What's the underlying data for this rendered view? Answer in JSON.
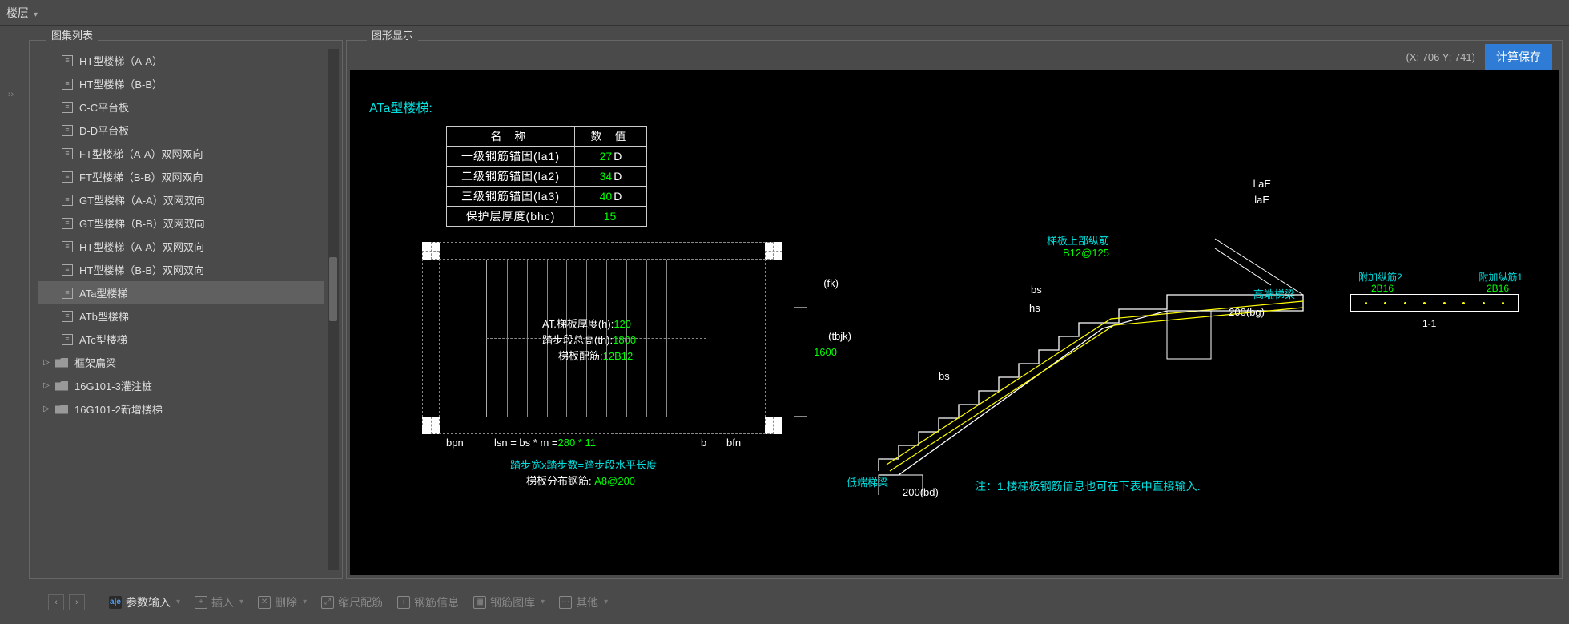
{
  "topbar": {
    "menu": "楼层"
  },
  "sidebar": {
    "title": "图集列表",
    "items": [
      {
        "label": "HT型楼梯（A-A）"
      },
      {
        "label": "HT型楼梯（B-B）"
      },
      {
        "label": "C-C平台板"
      },
      {
        "label": "D-D平台板"
      },
      {
        "label": "FT型楼梯（A-A）双网双向"
      },
      {
        "label": "FT型楼梯（B-B）双网双向"
      },
      {
        "label": "GT型楼梯（A-A）双网双向"
      },
      {
        "label": "GT型楼梯（B-B）双网双向"
      },
      {
        "label": "HT型楼梯（A-A）双网双向"
      },
      {
        "label": "HT型楼梯（B-B）双网双向"
      },
      {
        "label": "ATa型楼梯",
        "selected": true
      },
      {
        "label": "ATb型楼梯"
      },
      {
        "label": "ATc型楼梯"
      }
    ],
    "groups": [
      {
        "label": "框架扁梁"
      },
      {
        "label": "16G101-3灌注桩"
      },
      {
        "label": "16G101-2新增楼梯"
      }
    ]
  },
  "graphic": {
    "title": "图形显示",
    "coords_prefix": "(X: ",
    "coords_mid": " Y: ",
    "coords_suffix": ")",
    "x": "706",
    "y": "741",
    "save_btn": "计算保存"
  },
  "drawing": {
    "title": "ATa型楼梯:",
    "table_headers": {
      "name": "名  称",
      "value": "数  值"
    },
    "params": [
      {
        "name": "一级钢筋锚固(la1)",
        "value": "27",
        "unit": "D"
      },
      {
        "name": "二级钢筋锚固(la2)",
        "value": "34",
        "unit": "D"
      },
      {
        "name": "三级钢筋锚固(la3)",
        "value": "40",
        "unit": "D"
      },
      {
        "name": "保护层厚度(bhc)",
        "value": "15",
        "unit": ""
      }
    ],
    "plan": {
      "line1_pre": "AT.梯板厚度(h):",
      "line1_val": "120",
      "line2_pre": "踏步段总高(th):",
      "line2_val": "1800",
      "line3_pre": "梯板配筋:",
      "line3_val": "12B12",
      "fk": "(fk)",
      "tbjk_lbl": "(tbjk)",
      "tbjk_val": "1600",
      "bpn": "bpn",
      "lsn_pre": "lsn = bs * m =",
      "lsn_val": "280 * 11",
      "b": "b",
      "bfn": "bfn",
      "bottom1": "踏步宽x踏步数=踏步段水平长度",
      "bottom2_pre": "梯板分布钢筋:",
      "bottom2_val": "A8@200"
    },
    "section": {
      "laE1": "l aE",
      "laE2": "laE",
      "top_rebar_lbl": "梯板上部纵筋",
      "top_rebar_val": "B12@125",
      "bs": "bs",
      "hs": "hs",
      "high_beam": "高端梯梁",
      "bg_val": "200",
      "bg_lbl": "(bg)",
      "low_beam": "低端梯梁",
      "bd_val": "200",
      "bd_lbl": "(bd)",
      "note": "注：1.楼梯板钢筋信息也可在下表中直接输入."
    },
    "detail": {
      "add2_lbl": "附加纵筋2",
      "add2_val": "2B16",
      "add1_lbl": "附加纵筋1",
      "add1_val": "2B16",
      "section_lbl": "1-1"
    }
  },
  "bottombar": {
    "param_input": "参数输入",
    "insert": "插入",
    "delete": "删除",
    "scale": "缩尺配筋",
    "rebar_info": "钢筋信息",
    "rebar_lib": "钢筋图库",
    "other": "其他"
  }
}
